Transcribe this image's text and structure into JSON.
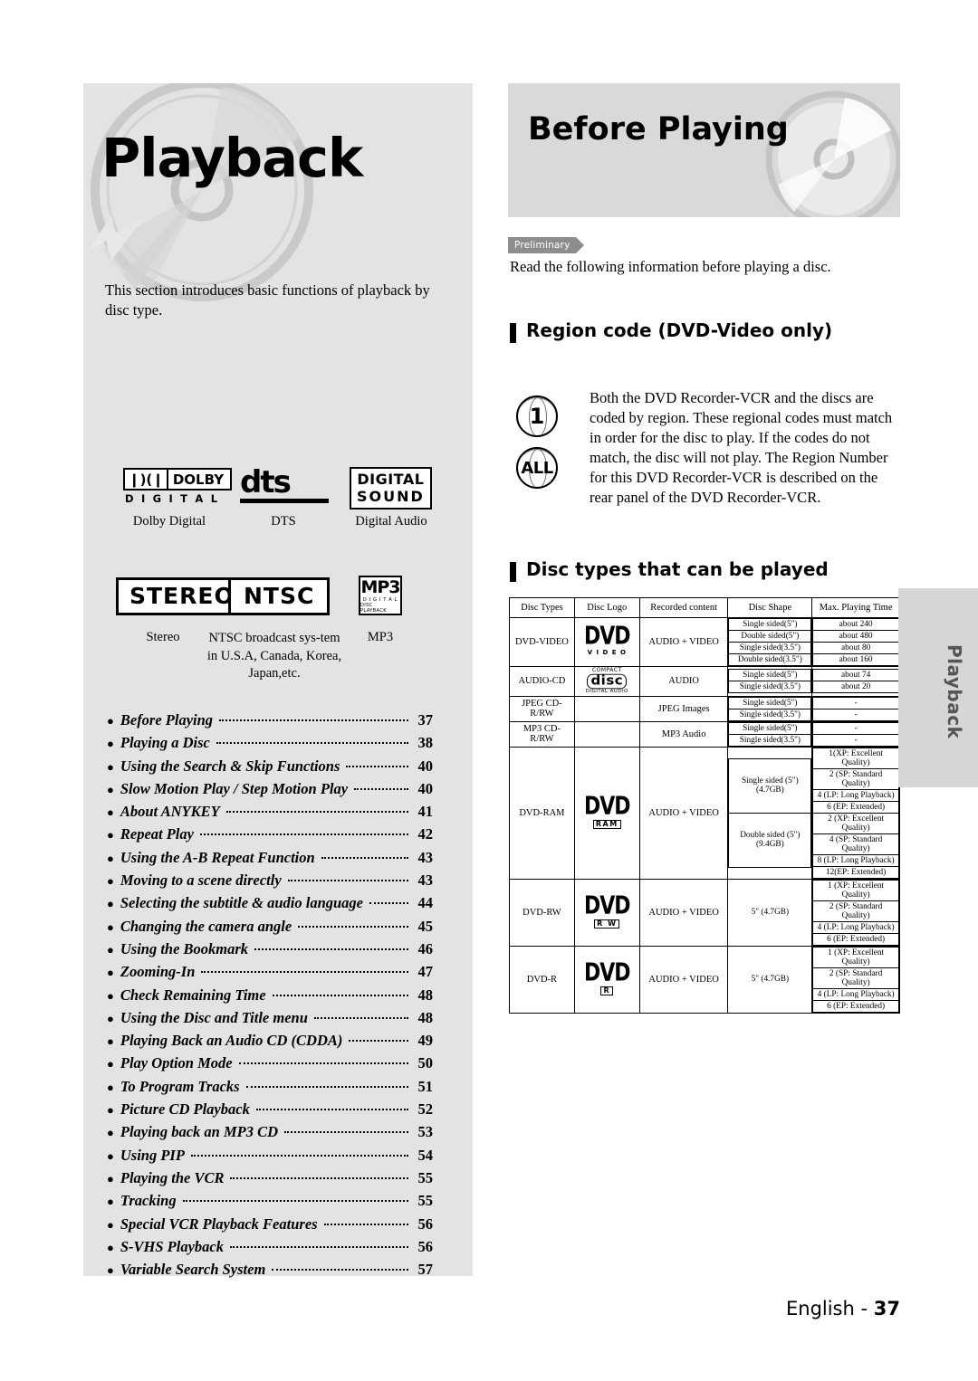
{
  "left": {
    "title": "Playback",
    "intro": "This section introduces basic functions of playback by disc type.",
    "logos_row1": [
      {
        "icon": "dolby-digital-logo",
        "caption": "Dolby Digital",
        "text_main": "DOLBY",
        "text_sub": "D I G I T A L"
      },
      {
        "icon": "dts-logo",
        "caption": "DTS",
        "text_main": "dts"
      },
      {
        "icon": "digital-sound-logo",
        "caption": "Digital Audio",
        "line1": "DIGITAL",
        "line2": "SOUND"
      }
    ],
    "logos_row2": [
      {
        "icon": "stereo-logo",
        "label": "STEREO",
        "caption": "Stereo"
      },
      {
        "icon": "ntsc-logo",
        "label": "NTSC",
        "caption": "NTSC broadcast sys-tem in U.S.A, Canada, Korea, Japan,etc."
      },
      {
        "icon": "mp3-logo",
        "label": "MP3",
        "caption": "MP3",
        "sub1": "D I G I T A L",
        "sub2": "DISC PLAYBACK"
      }
    ],
    "toc": [
      {
        "label": "Before Playing",
        "page": "37"
      },
      {
        "label": "Playing a Disc",
        "page": "38"
      },
      {
        "label": "Using the Search & Skip Functions",
        "page": "40"
      },
      {
        "label": "Slow Motion Play / Step Motion Play",
        "page": "40"
      },
      {
        "label": "About ANYKEY",
        "page": "41"
      },
      {
        "label": "Repeat Play",
        "page": "42"
      },
      {
        "label": "Using the A-B Repeat Function",
        "page": "43"
      },
      {
        "label": "Moving to a scene directly",
        "page": "43"
      },
      {
        "label": "Selecting the subtitle & audio language",
        "page": "44"
      },
      {
        "label": "Changing the camera angle",
        "page": "45"
      },
      {
        "label": "Using the Bookmark",
        "page": "46"
      },
      {
        "label": "Zooming-In",
        "page": "47"
      },
      {
        "label": "Check Remaining Time",
        "page": "48"
      },
      {
        "label": "Using the Disc and Title menu",
        "page": "48"
      },
      {
        "label": "Playing Back an Audio CD (CDDA)",
        "page": "49"
      },
      {
        "label": "Play Option Mode",
        "page": "50"
      },
      {
        "label": "To Program Tracks",
        "page": "51"
      },
      {
        "label": "Picture CD Playback",
        "page": "52"
      },
      {
        "label": "Playing back an MP3 CD",
        "page": "53"
      },
      {
        "label": "Using PIP",
        "page": "54"
      },
      {
        "label": "Playing the VCR",
        "page": "55"
      },
      {
        "label": "Tracking",
        "page": "55"
      },
      {
        "label": "Special VCR Playback Features",
        "page": "56"
      },
      {
        "label": "S-VHS Playback",
        "page": "56"
      },
      {
        "label": "Variable Search System",
        "page": "57"
      }
    ]
  },
  "right": {
    "header_title": "Before Playing",
    "preliminary_tag": "Preliminary",
    "read_following": "Read the following information before playing a disc.",
    "section_region_title": "Region code (DVD-Video only)",
    "region_body": "Both the DVD Recorder-VCR and the discs are coded by region. These regional codes must match in order for the disc to play. If the codes do not match, the disc will not play. The Region Number for this DVD Recorder-VCR is described on the rear panel of the DVD Recorder-VCR.",
    "globe_1": "1",
    "globe_all": "ALL",
    "section_disctypes_title": "Disc types that can be played",
    "table": {
      "headers": [
        "Disc Types",
        "Disc Logo",
        "Recorded content",
        "Disc Shape",
        "Max. Playing Time"
      ],
      "rows": [
        {
          "type": "DVD-VIDEO",
          "logo": {
            "icon": "dvd-video-logo",
            "word": "DVD",
            "sub": "V I D E O"
          },
          "content": "AUDIO + VIDEO",
          "shapes": [
            "Single sided(5\")",
            "Double sided(5\")",
            "Single sided(3.5\")",
            "Double sided(3.5\")"
          ],
          "times": [
            "about 240",
            "about 480",
            "about 80",
            "about 160"
          ]
        },
        {
          "type": "AUDIO-CD",
          "logo": {
            "icon": "compact-disc-digital-audio-logo",
            "top": "COMPACT",
            "mid": "disc",
            "bottom": "DIGITAL AUDIO"
          },
          "content": "AUDIO",
          "shapes": [
            "Single sided(5\")",
            "Single sided(3.5\")"
          ],
          "times": [
            "about 74",
            "about 20"
          ]
        },
        {
          "type": "JPEG CD-R/RW",
          "logo": null,
          "content": "JPEG Images",
          "shapes": [
            "Single sided(5\")",
            "Single sided(3.5\")"
          ],
          "times": [
            "-",
            "-"
          ]
        },
        {
          "type": "MP3 CD-R/RW",
          "logo": null,
          "content": "MP3 Audio",
          "shapes": [
            "Single sided(5\")",
            "Single sided(3.5\")"
          ],
          "times": [
            "-",
            "-"
          ]
        },
        {
          "type": "DVD-RAM",
          "logo": {
            "icon": "dvd-ram-logo",
            "word": "DVD",
            "sub": "RAM"
          },
          "content": "AUDIO + VIDEO",
          "shape_groups": [
            {
              "shape": "Single sided (5\") (4.7GB)",
              "times": [
                "1(XP: Excellent Quality)",
                "2 (SP: Standard Quality)",
                "4 (LP: Long Playback)",
                "6 (EP: Extended)"
              ]
            },
            {
              "shape": "Double sided (5\") (9.4GB)",
              "times": [
                "2 (XP: Excellent Quality)",
                "4 (SP: Standard Quality)",
                "8 (LP: Long Playback)",
                "12(EP: Extended)"
              ]
            }
          ]
        },
        {
          "type": "DVD-RW",
          "logo": {
            "icon": "dvd-rw-logo",
            "word": "DVD",
            "sub": "R W"
          },
          "content": "AUDIO + VIDEO",
          "shape": "5\" (4.7GB)",
          "times": [
            "1 (XP: Excellent Quality)",
            "2 (SP: Standard Quality)",
            "4 (LP: Long Playback)",
            "6 (EP: Extended)"
          ]
        },
        {
          "type": "DVD-R",
          "logo": {
            "icon": "dvd-r-logo",
            "word": "DVD",
            "sub": "R"
          },
          "content": "AUDIO + VIDEO",
          "shape": "5\" (4.7GB)",
          "times": [
            "1 (XP: Excellent Quality)",
            "2 (SP: Standard Quality)",
            "4 (LP: Long Playback)",
            "6 (EP: Extended)"
          ]
        }
      ]
    },
    "side_tab": "Playback",
    "footer_language": "English -",
    "footer_page": "37"
  }
}
